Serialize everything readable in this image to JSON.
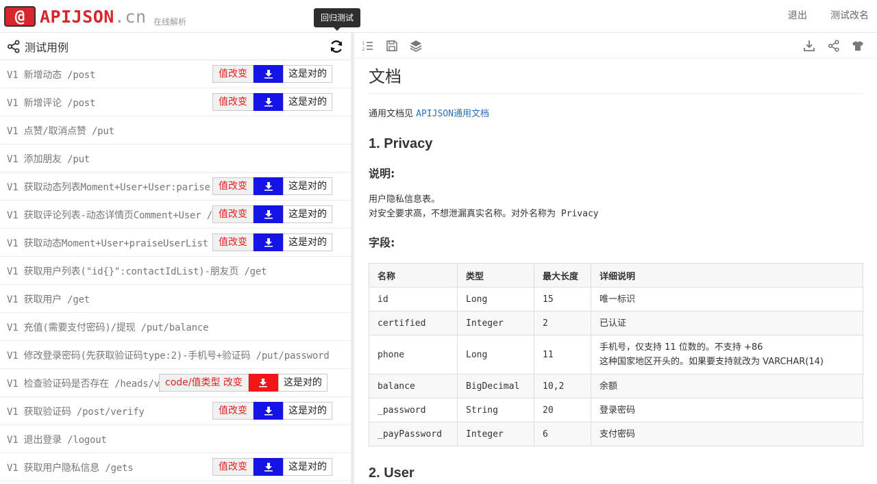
{
  "header": {
    "logo_badge": "@",
    "logo_main": "APIJSON",
    "logo_suffix": ".cn",
    "subtitle": "在线解析",
    "tooltip": "回归测试",
    "actions": [
      "退出",
      "测试改名"
    ]
  },
  "left": {
    "title": "测试用例",
    "cases": [
      {
        "name": "V1 新增动态 /post",
        "badge": "single"
      },
      {
        "name": "V1 新增评论 /post",
        "badge": "single"
      },
      {
        "name": "V1 点赞/取消点赞 /put",
        "badge": "none"
      },
      {
        "name": "V1 添加朋友 /put",
        "badge": "none"
      },
      {
        "name": "V1 获取动态列表Moment+User+User:parise",
        "badge": "single"
      },
      {
        "name": "V1 获取评论列表-动态详情页Comment+User /",
        "badge": "single"
      },
      {
        "name": "V1 获取动态Moment+User+praiseUserList",
        "badge": "single"
      },
      {
        "name": "V1 获取用户列表(\"id{}\":contactIdList)-朋友页 /get",
        "badge": "none"
      },
      {
        "name": "V1 获取用户 /get",
        "badge": "none"
      },
      {
        "name": "V1 充值(需要支付密码)/提现 /put/balance",
        "badge": "none"
      },
      {
        "name": "V1 修改登录密码(先获取验证码type:2)-手机号+验证码 /put/password",
        "badge": "none"
      },
      {
        "name": "V1 检查验证码是否存在 /heads/v",
        "badge": "code"
      },
      {
        "name": "V1 获取验证码 /post/verify",
        "badge": "single"
      },
      {
        "name": "V1 退出登录 /logout",
        "badge": "none"
      },
      {
        "name": "V1 获取用户隐私信息 /gets",
        "badge": "single"
      }
    ],
    "badge_change": "值改变",
    "badge_code_change": "code/值类型 改变",
    "badge_ok": "这是对的"
  },
  "doc": {
    "title": "文档",
    "intro_prefix": "通用文档见",
    "intro_link": "APIJSON通用文档",
    "section1": "1. Privacy",
    "explain_label": "说明:",
    "explain_line1": "用户隐私信息表。",
    "explain_line2": "对安全要求高，不想泄漏真实名称。对外名称为 Privacy",
    "fields_label": "字段:",
    "columns": [
      "名称",
      "类型",
      "最大长度",
      "详细说明"
    ],
    "rows": [
      {
        "name": "id",
        "type": "Long",
        "len": "15",
        "desc": "唯一标识",
        "desc2": ""
      },
      {
        "name": "certified",
        "type": "Integer",
        "len": "2",
        "desc": "已认证",
        "desc2": ""
      },
      {
        "name": "phone",
        "type": "Long",
        "len": "11",
        "desc": "手机号，仅支持 11 位数的。不支持 +86",
        "desc2": "这种国家地区开头的。如果要支持就改为 VARCHAR(14)"
      },
      {
        "name": "balance",
        "type": "BigDecimal",
        "len": "10,2",
        "desc": "余额",
        "desc2": ""
      },
      {
        "name": "_password",
        "type": "String",
        "len": "20",
        "desc": "登录密码",
        "desc2": ""
      },
      {
        "name": "_payPassword",
        "type": "Integer",
        "len": "6",
        "desc": "支付密码",
        "desc2": ""
      }
    ],
    "section2": "2. User"
  },
  "colors": {
    "brand_red": "#d9262c",
    "badge_blue": "#1414e6",
    "badge_red": "#f21616",
    "link_blue": "#2a6fb6"
  }
}
